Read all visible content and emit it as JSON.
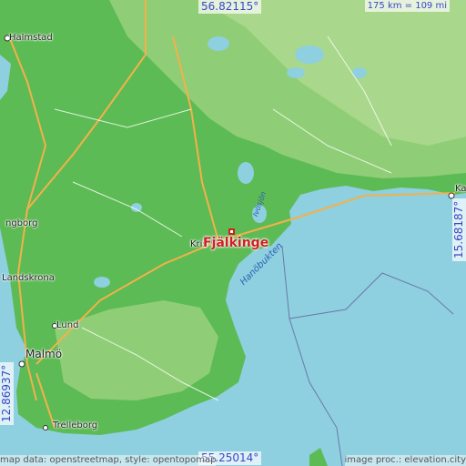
{
  "map": {
    "target": "Fjälkinge",
    "coordinates": {
      "lat_top": "56.82115°",
      "lat_bottom": "55.25014°",
      "lon_left": "12.86937°",
      "lon_right": "15.68187°"
    },
    "scale": "175 km = 109 mi",
    "places": {
      "halmstad": "Halmstad",
      "helsingborg": "ngborg",
      "landskrona": "Landskrona",
      "lund": "Lund",
      "malmo": "Malmö",
      "trelleborg": "Trelleborg",
      "kristianstad": "Kris",
      "karlskrona": "Ka"
    },
    "water": {
      "hanobukten": "Hanöbukten",
      "ivosjon": "Ivösjön"
    },
    "credits": {
      "left": "map data: openstreetmap, style: opentopomap",
      "right": "image proc.: elevation.city"
    },
    "colors": {
      "sea": "#8ecfe0",
      "low_land": "#4fb84a",
      "mid_land": "#7ac86b",
      "high_land": "#a9d88c",
      "marker": "#d02020",
      "coord_text": "#3b46c8"
    }
  }
}
